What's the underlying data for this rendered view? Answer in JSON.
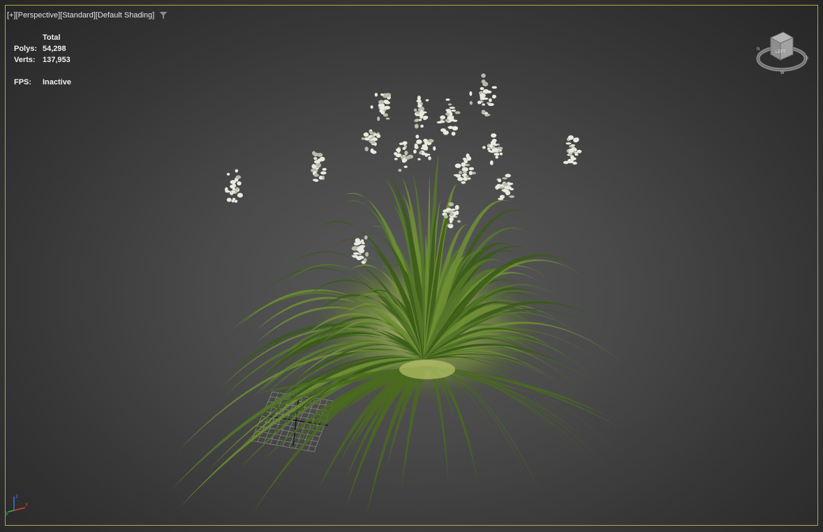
{
  "viewport": {
    "labels": [
      "[+]",
      "[Perspective]",
      "[Standard]",
      "[Default Shading]"
    ]
  },
  "stats": {
    "header": "Total",
    "polys_label": "Polys:",
    "polys_value": "54,298",
    "verts_label": "Verts:",
    "verts_value": "137,953",
    "fps_label": "FPS:",
    "fps_value": "Inactive"
  },
  "navcube": {
    "face_label": "LEFT"
  },
  "axes": {
    "z": "z",
    "x": "x",
    "y": "y"
  },
  "colors": {
    "frame": "#b9a64a",
    "grass_dark": "#2f4a14",
    "grass_light": "#b8c868",
    "flower": "#e8eadf"
  }
}
